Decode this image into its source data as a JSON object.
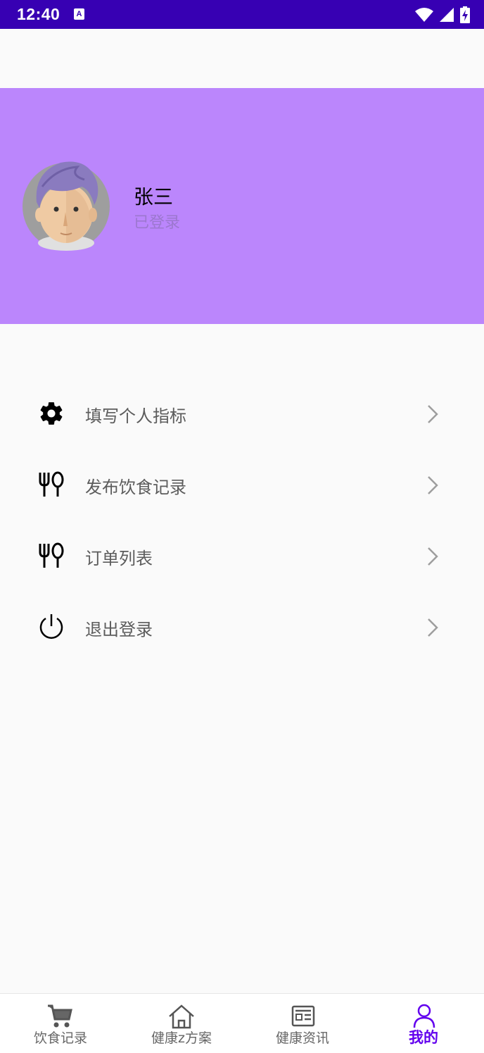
{
  "status_bar": {
    "time": "12:40",
    "notification_icon": "a-icon",
    "icons": [
      "wifi-icon",
      "signal-icon",
      "battery-charging-icon"
    ]
  },
  "profile": {
    "name": "张三",
    "status": "已登录",
    "avatar_icon": "avatar-cartoon-man"
  },
  "menu": {
    "items": [
      {
        "icon": "gear-icon",
        "label": "填写个人指标"
      },
      {
        "icon": "fork-spoon-icon",
        "label": "发布饮食记录"
      },
      {
        "icon": "fork-spoon-icon",
        "label": "订单列表"
      },
      {
        "icon": "power-icon",
        "label": "退出登录"
      }
    ]
  },
  "bottom_nav": {
    "items": [
      {
        "icon": "cart-icon",
        "label": "饮食记录",
        "active": false
      },
      {
        "icon": "home-icon",
        "label": "健康z方案",
        "active": false
      },
      {
        "icon": "news-icon",
        "label": "健康资讯",
        "active": false
      },
      {
        "icon": "person-icon",
        "label": "我的",
        "active": true
      }
    ]
  },
  "colors": {
    "status_bar": "#3700b3",
    "header": "#bb86fc",
    "accent": "#6200ee"
  }
}
